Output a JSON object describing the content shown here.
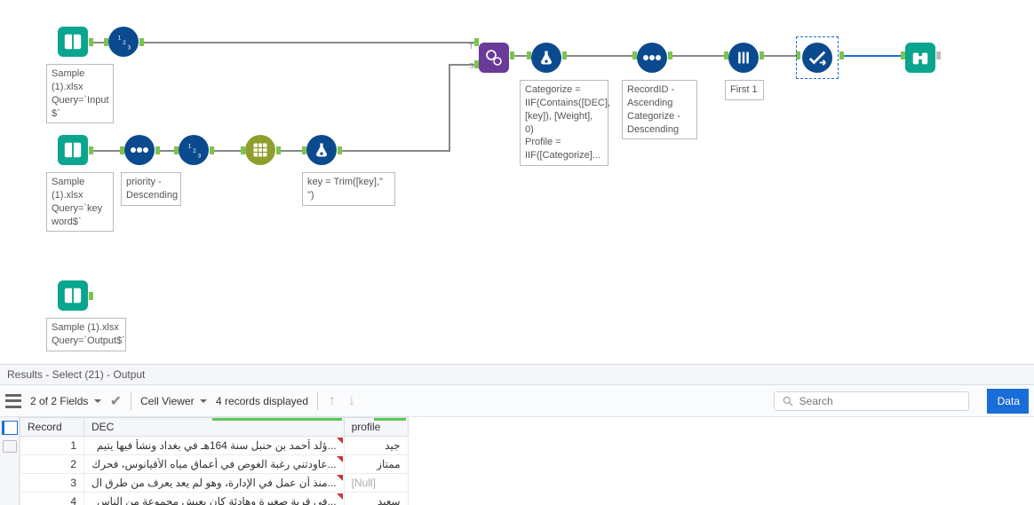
{
  "canvas": {
    "nodes": {
      "input1": {
        "label": "Sample (1).xlsx\nQuery=`Input $`"
      },
      "input2": {
        "label": "Sample (1).xlsx\nQuery=`key word$`"
      },
      "input3": {
        "label": "Sample (1).xlsx\nQuery=`Output$`"
      },
      "sort1": {
        "label": "priority - Descending"
      },
      "formula1": {
        "label": "key = Trim([key],\" \")"
      },
      "formula2": {
        "label": "Categorize = IIF(Contains([DEC], [key]), [Weight], 0)\nProfile = IIF([Categorize]..."
      },
      "sort2": {
        "label": "RecordID - Ascending\nCategorize - Descending"
      },
      "sample1": {
        "label": "First 1"
      }
    }
  },
  "results": {
    "header": "Results - Select (21) - Output",
    "fields_label": "2 of 2 Fields",
    "cell_viewer": "Cell Viewer",
    "records_displayed": "4 records displayed",
    "search_placeholder": "Search",
    "data_btn": "Data",
    "columns": {
      "record": "Record",
      "dec": "DEC",
      "profile": "profile"
    },
    "rows": [
      {
        "record": "1",
        "dec": "...ؤلد أحمد بن حنبل سنة 164هـ في بغداد ونشأ فيها يتيم",
        "profile": "جيد"
      },
      {
        "record": "2",
        "dec": "...عاودتني رغبة الغوص في أعماق مياه الأقيانوس، فحرك",
        "profile": "ممتاز"
      },
      {
        "record": "3",
        "dec": "...منذ أن عمل في الإدارة، وهو لم يعد يعرف من طرق ال",
        "profile": "[Null]"
      },
      {
        "record": "4",
        "dec": "...في قرية صغيرة وهادئة كان يعيش مجموعة من الناس",
        "profile": "سعيد"
      }
    ]
  }
}
